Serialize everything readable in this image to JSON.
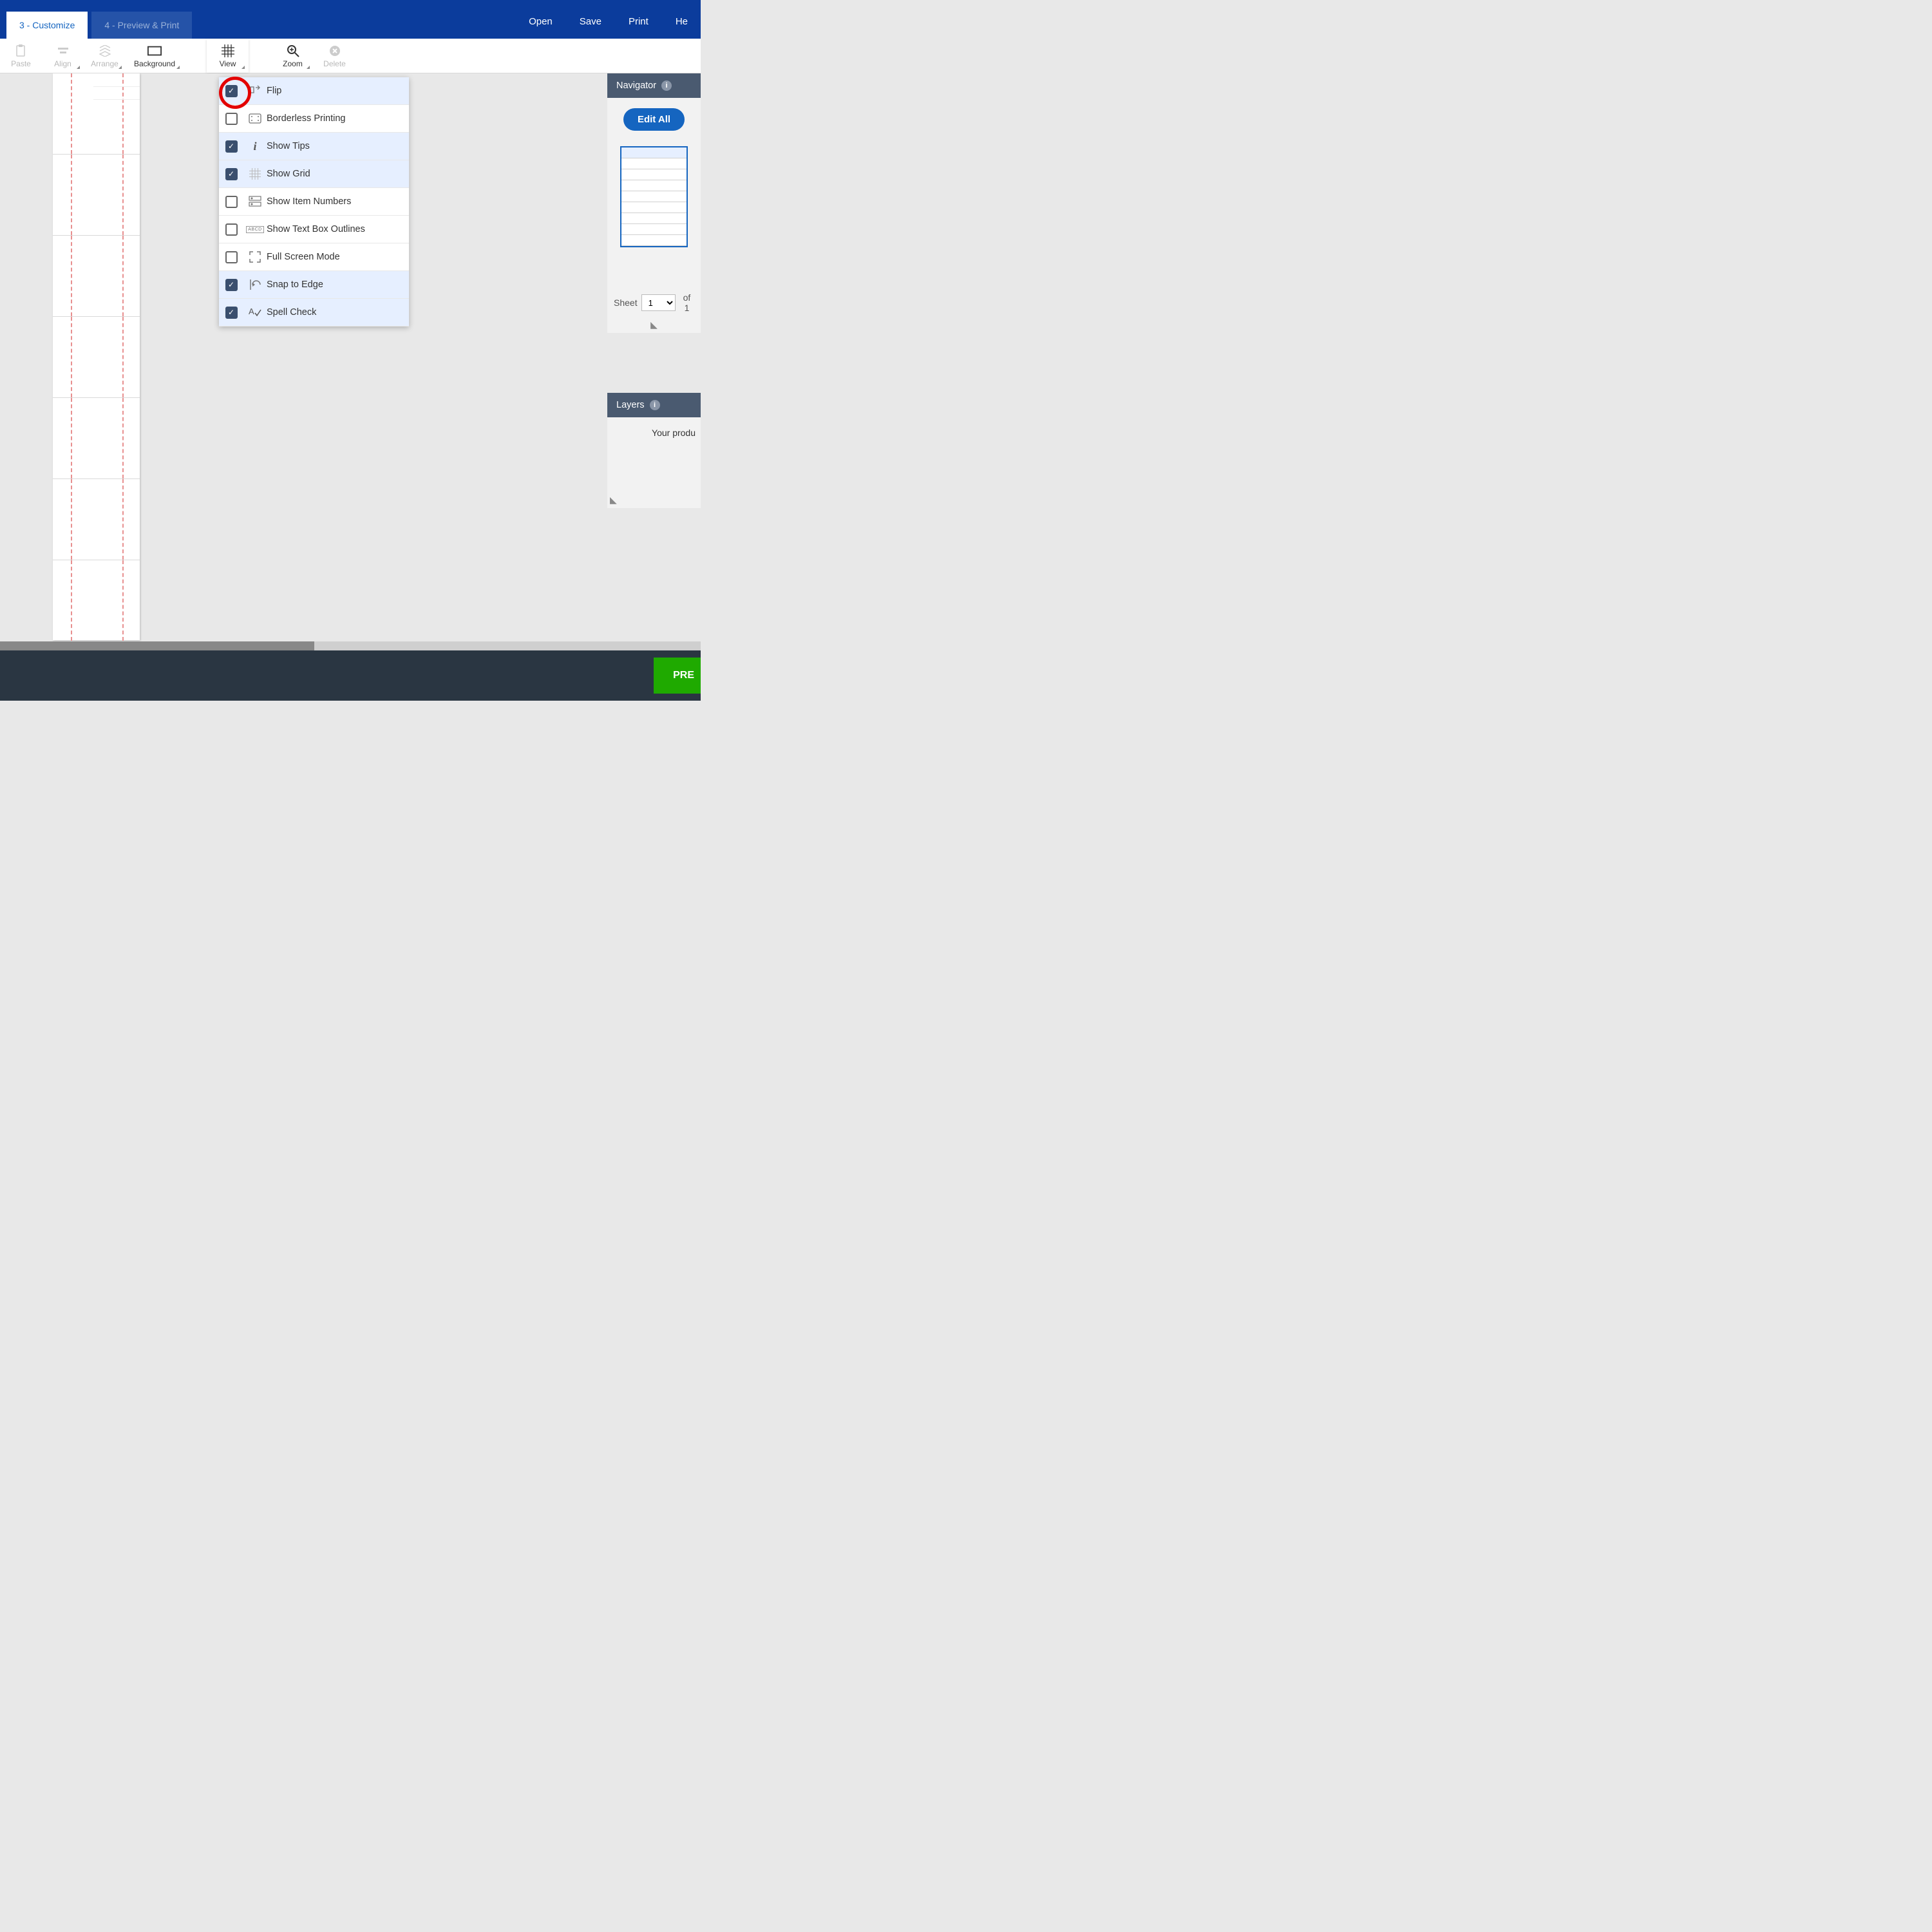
{
  "tabs": {
    "customize": "3 - Customize",
    "preview": "4 - Preview & Print"
  },
  "topActions": {
    "open": "Open",
    "save": "Save",
    "print": "Print",
    "help": "He"
  },
  "toolbar": {
    "paste": "Paste",
    "align": "Align",
    "arrange": "Arrange",
    "background": "Background",
    "view": "View",
    "zoom": "Zoom",
    "delete": "Delete"
  },
  "viewMenu": {
    "items": [
      {
        "label": "Flip",
        "checked": true
      },
      {
        "label": "Borderless Printing",
        "checked": false
      },
      {
        "label": "Show Tips",
        "checked": true
      },
      {
        "label": "Show Grid",
        "checked": true
      },
      {
        "label": "Show Item Numbers",
        "checked": false
      },
      {
        "label": "Show Text Box Outlines",
        "checked": false
      },
      {
        "label": "Full Screen Mode",
        "checked": false
      },
      {
        "label": "Snap to Edge",
        "checked": true
      },
      {
        "label": "Spell Check",
        "checked": true
      }
    ]
  },
  "navigator": {
    "title": "Navigator",
    "editAll": "Edit All",
    "sheetLabel": "Sheet",
    "sheetValue": "1",
    "ofLabel": "of 1"
  },
  "layers": {
    "title": "Layers",
    "body": "Your produ"
  },
  "footer": {
    "preview": "PRE"
  }
}
